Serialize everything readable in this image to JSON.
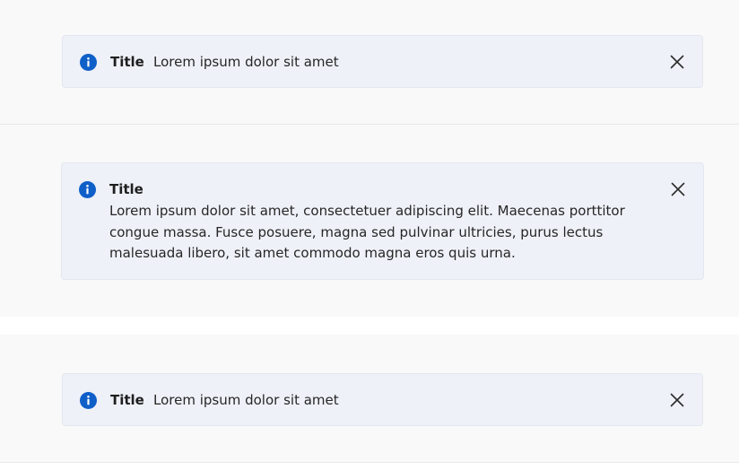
{
  "colors": {
    "accent": "#0f5fc8",
    "bar_background": "#eef1f8",
    "panel_background": "#f9f9f9",
    "text": "#1f1f1f"
  },
  "banners": [
    {
      "icon": "info-icon",
      "title": "Title",
      "message": "Lorem ipsum dolor sit amet",
      "close_icon": "close-icon"
    },
    {
      "icon": "info-icon",
      "title": "Title",
      "message": "Lorem ipsum dolor sit amet, consectetuer adipiscing elit. Maecenas porttitor congue massa. Fusce posuere, magna sed pulvinar ultricies, purus lectus malesuada libero, sit amet commodo magna eros quis urna.",
      "close_icon": "close-icon"
    },
    {
      "icon": "info-icon",
      "title": "Title",
      "message": "Lorem ipsum dolor sit amet",
      "close_icon": "close-icon"
    }
  ]
}
